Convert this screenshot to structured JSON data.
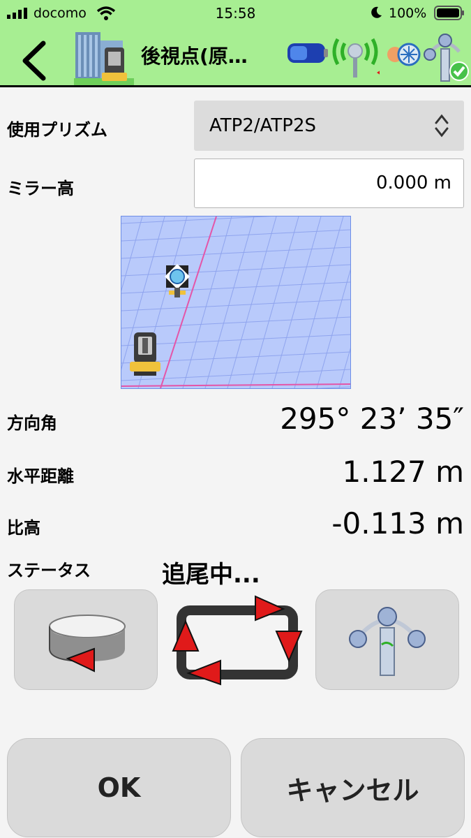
{
  "status_bar": {
    "carrier": "docomo",
    "time": "15:58",
    "battery_percent": "100%"
  },
  "title_bar": {
    "title": "後視点(原…",
    "icons": [
      "back-chevron-icon",
      "instrument-building-icon",
      "battery-icon",
      "signal-antenna-icon",
      "prism-connection-icon",
      "status-ok-icon"
    ]
  },
  "form": {
    "prism_label": "使用プリズム",
    "prism_value": "ATP2/ATP2S",
    "mirror_label": "ミラー高",
    "mirror_value": "0.000 m"
  },
  "results": {
    "azimuth_label": "方向角",
    "azimuth_value": "295° 23’ 35″",
    "hdist_label": "水平距離",
    "hdist_value": "1.127 m",
    "height_label": "比高",
    "height_value": "-0.113 m",
    "status_label": "ステータス",
    "status_value": "追尾中..."
  },
  "buttons": {
    "ok": "OK",
    "cancel": "キャンセル"
  },
  "colors": {
    "header_bg": "#a7ee92",
    "map_bg": "#b9cafb",
    "arrow_red": "#e01a1a"
  }
}
